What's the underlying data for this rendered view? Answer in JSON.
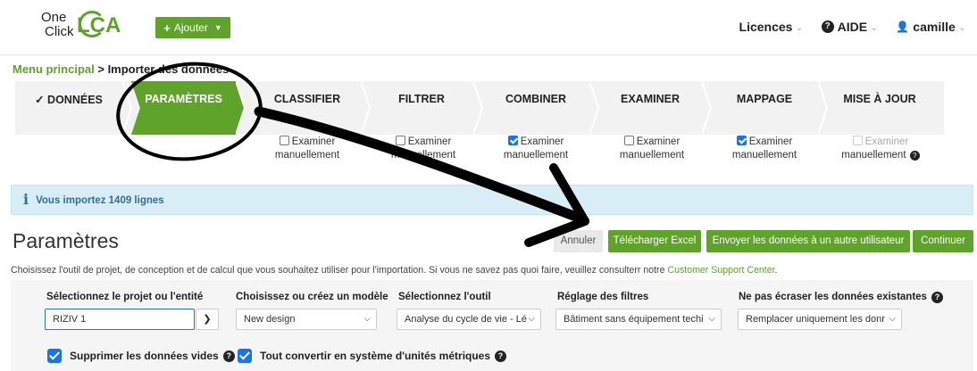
{
  "header": {
    "logo": {
      "one": "One",
      "click": "Click",
      "lca": "LCA"
    },
    "add_button": "Ajouter",
    "nav": [
      {
        "label": "Licences",
        "icon": ""
      },
      {
        "label": "AIDE",
        "icon": "help-circle-icon"
      },
      {
        "label": "camille",
        "icon": "user-icon"
      }
    ]
  },
  "breadcrumb": {
    "link": "Menu principal",
    "separator": " > ",
    "current": "Importer des données"
  },
  "steps": [
    {
      "label": "✓ DONNÉES",
      "active": false
    },
    {
      "label": "PARAMÈTRES",
      "active": true
    },
    {
      "label": "CLASSIFIER",
      "active": false
    },
    {
      "label": "FILTRER",
      "active": false
    },
    {
      "label": "COMBINER",
      "active": false
    },
    {
      "label": "EXAMINER",
      "active": false
    },
    {
      "label": "MAPPAGE",
      "active": false
    },
    {
      "label": "MISE À JOUR",
      "active": false
    }
  ],
  "review_checks": [
    {
      "line1": "Examiner",
      "line2": "manuellement",
      "checked": false,
      "disabled": false
    },
    {
      "line1": "Examiner",
      "line2": "manuellement",
      "checked": false,
      "disabled": false
    },
    {
      "line1": "Examiner",
      "line2": "manuellement",
      "checked": true,
      "disabled": false
    },
    {
      "line1": "Examiner",
      "line2": "manuellement",
      "checked": false,
      "disabled": false
    },
    {
      "line1": "Examiner",
      "line2": "manuellement",
      "checked": true,
      "disabled": false
    },
    {
      "line1": "Examiner",
      "line2": "manuellement",
      "checked": false,
      "disabled": true
    }
  ],
  "info_banner": "Vous importez 1409 lignes",
  "page_title": "Paramètres",
  "buttons": {
    "cancel": "Annuler",
    "download": "Télécharger Excel",
    "send": "Envoyer les données à un autre utilisateur",
    "continue": "Continuer"
  },
  "description": {
    "text": "Choisissez l'outil de projet, de conception et de calcul que vous souhaitez utiliser pour l'importation. Si vous ne savez pas quoi faire, veuillez consulterr notre ",
    "link": "Customer Support Center",
    "end": "."
  },
  "form": {
    "project": {
      "label": "Sélectionnez le projet ou l'entité",
      "value": "RIZIV 1"
    },
    "model": {
      "label": "Choisissez ou créez un modèle",
      "value": "New design"
    },
    "tool": {
      "label": "Sélectionnez l'outil",
      "value": "Analyse du cycle de vie - Lé"
    },
    "filters": {
      "label": "Réglage des filtres",
      "value": "Bâtiment sans équipement techi"
    },
    "overwrite": {
      "label": "Ne pas écraser les données existantes",
      "value": "Remplacer uniquement les donr"
    }
  },
  "options": {
    "remove_empty": "Supprimer les données vides",
    "convert_metric": "Tout convertir en système d'unités métriques"
  },
  "colors": {
    "brand_green": "#5fa32a",
    "info_bg": "#d9edf7",
    "checkbox_blue": "#1a73e8"
  }
}
